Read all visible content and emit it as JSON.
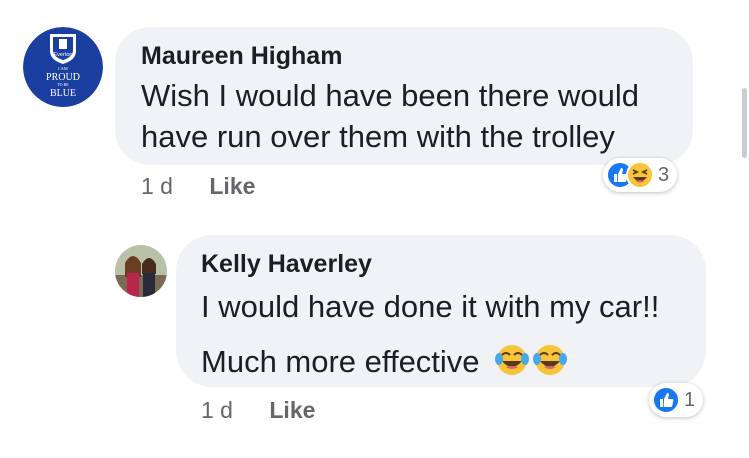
{
  "comments": [
    {
      "author": "Maureen Higham",
      "line1": "Wish  I would have been there would",
      "line2": "have run over them with the trolley",
      "time": "1 d",
      "like_label": "Like",
      "avatar_text": {
        "badge": "Everton",
        "top": "I AM",
        "main": "PROUD",
        "small": "TO BE",
        "bottom": "BLUE"
      },
      "reactions": {
        "icons": [
          "like-icon",
          "laugh-icon"
        ],
        "count": "3"
      }
    },
    {
      "author": "Kelly Haverley",
      "line1": "I would have done it with my car!!",
      "line2": "Much more effective",
      "emoji": "tears-of-joy-emoji",
      "time": "1 d",
      "like_label": "Like",
      "reactions": {
        "icons": [
          "like-icon"
        ],
        "count": "1"
      }
    }
  ],
  "colors": {
    "bubble": "#f0f2f5",
    "meta": "#65676b",
    "like_blue": "#1877f2",
    "everton_blue": "#1b3fa0"
  }
}
